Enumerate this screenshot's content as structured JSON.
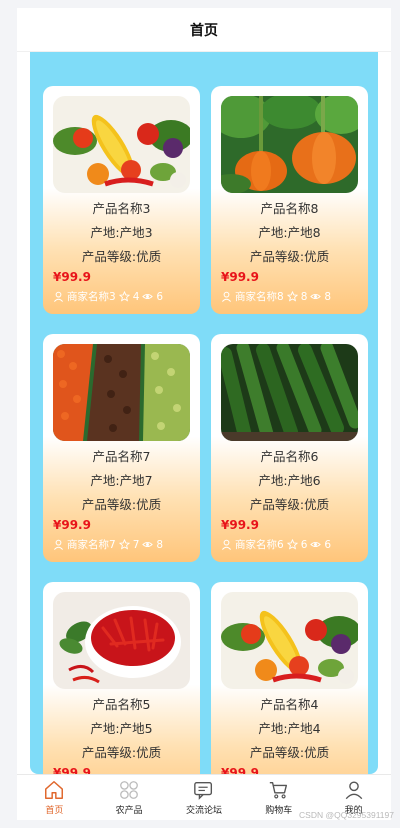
{
  "header": {
    "title": "首页"
  },
  "products": [
    {
      "name": "产品名称3",
      "origin": "产地:产地3",
      "grade": "产品等级:优质",
      "price": "¥99.9",
      "merchant": "商家名称3",
      "favorites": "4",
      "views": "6",
      "image": "vegetable-mix"
    },
    {
      "name": "产品名称8",
      "origin": "产地:产地8",
      "grade": "产品等级:优质",
      "price": "¥99.9",
      "merchant": "商家名称8",
      "favorites": "8",
      "views": "8",
      "image": "pumpkins"
    },
    {
      "name": "产品名称7",
      "origin": "产地:产地7",
      "grade": "产品等级:优质",
      "price": "¥99.9",
      "merchant": "商家名称7",
      "favorites": "7",
      "views": "8",
      "image": "tomato-market"
    },
    {
      "name": "产品名称6",
      "origin": "产地:产地6",
      "grade": "产品等级:优质",
      "price": "¥99.9",
      "merchant": "商家名称6",
      "favorites": "6",
      "views": "6",
      "image": "cucumbers"
    },
    {
      "name": "产品名称5",
      "origin": "产地:产地5",
      "grade": "产品等级:优质",
      "price": "¥99.9",
      "merchant": "",
      "favorites": "",
      "views": "",
      "image": "red-chilies"
    },
    {
      "name": "产品名称4",
      "origin": "产地:产地4",
      "grade": "产品等级:优质",
      "price": "¥99.9",
      "merchant": "",
      "favorites": "",
      "views": "",
      "image": "vegetable-mix"
    }
  ],
  "tabbar": {
    "items": [
      {
        "label": "首页",
        "icon": "home-icon",
        "active": true
      },
      {
        "label": "农产品",
        "icon": "grid-icon",
        "active": false
      },
      {
        "label": "交流论坛",
        "icon": "chat-icon",
        "active": false
      },
      {
        "label": "购物车",
        "icon": "cart-icon",
        "active": false
      },
      {
        "label": "我的",
        "icon": "user-icon",
        "active": false
      }
    ]
  },
  "colors": {
    "accent": "#e0672c",
    "price": "#e8141a",
    "content_bg": "#7fdcf8"
  },
  "watermark": "CSDN @QQ3295391197"
}
